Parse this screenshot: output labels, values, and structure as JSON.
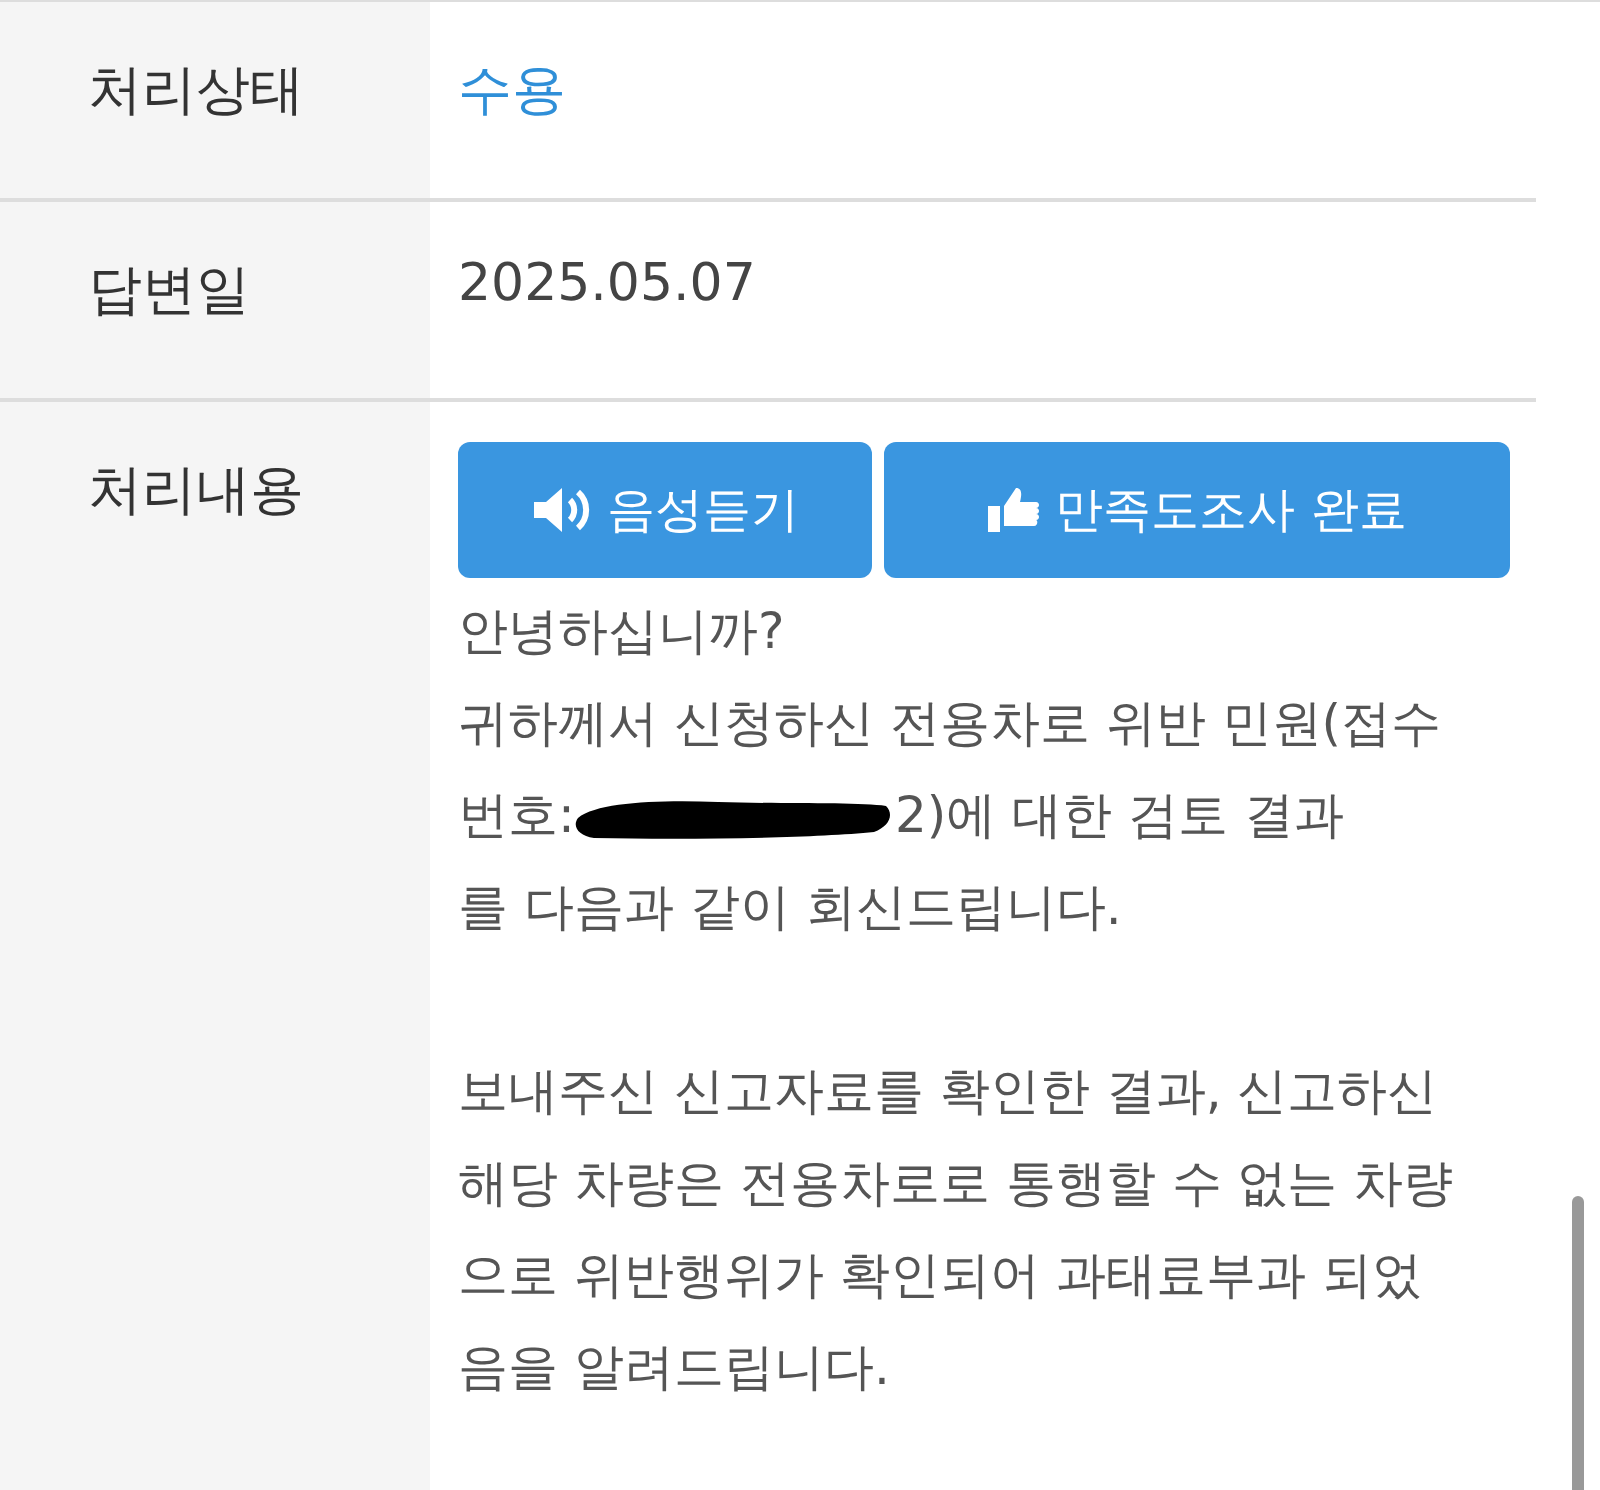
{
  "rows": [
    {
      "label": "처리상태",
      "kind": "status",
      "value": "수용"
    },
    {
      "label": "답변일",
      "kind": "text",
      "value": "2025.05.07"
    },
    {
      "label": "처리내용",
      "kind": "content",
      "buttons": [
        {
          "kind": "speaker",
          "label": "음성듣기"
        },
        {
          "kind": "thumb",
          "label": "만족도조사 완료"
        }
      ],
      "lines": [
        {
          "kind": "text",
          "text": "안녕하십니까?"
        },
        {
          "kind": "text",
          "text": "귀하께서 신청하신 전용차로 위반 민원(접수"
        },
        {
          "kind": "redacted",
          "before": "번호:",
          "after": "2)에 대한 검토 결과"
        },
        {
          "kind": "text",
          "text": "를 다음과 같이 회신드립니다."
        },
        {
          "kind": "blank"
        },
        {
          "kind": "text",
          "text": "보내주신 신고자료를 확인한 결과, 신고하신"
        },
        {
          "kind": "text",
          "text": "해당 차량은 전용차로로 통행할 수 없는 차량"
        },
        {
          "kind": "text",
          "text": "으로 위반행위가 확인되어 과태료부과 되었"
        },
        {
          "kind": "text",
          "text": "음을 알려드립니다."
        }
      ]
    }
  ]
}
